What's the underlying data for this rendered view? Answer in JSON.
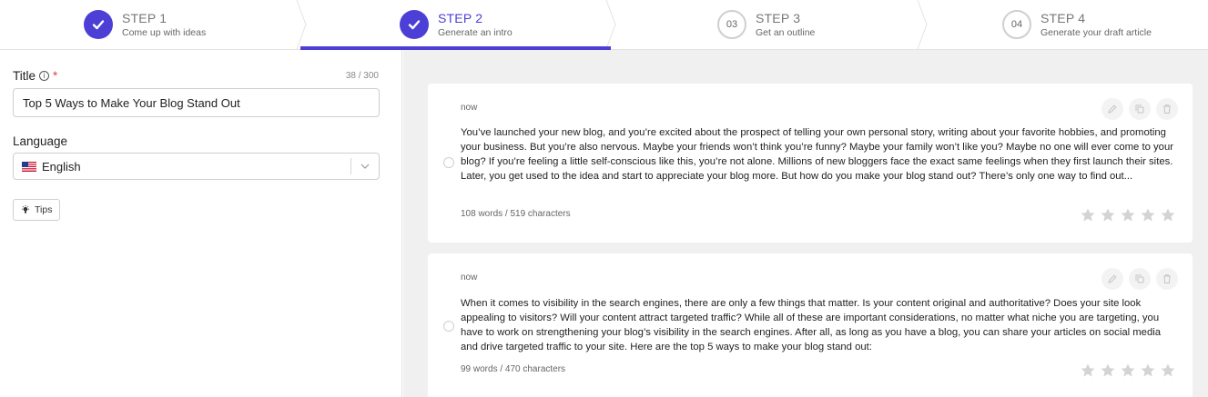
{
  "steps": [
    {
      "title": "STEP 1",
      "subtitle": "Come up with ideas",
      "state": "done"
    },
    {
      "title": "STEP 2",
      "subtitle": "Generate an intro",
      "state": "active"
    },
    {
      "title": "STEP 3",
      "subtitle": "Get an outline",
      "number": "03",
      "state": "todo"
    },
    {
      "title": "STEP 4",
      "subtitle": "Generate your draft article",
      "number": "04",
      "state": "todo"
    }
  ],
  "form": {
    "title_label": "Title",
    "required_mark": "*",
    "title_counter": "38 / 300",
    "title_value": "Top 5 Ways to Make Your Blog Stand Out",
    "language_label": "Language",
    "language_value": "English",
    "tips_label": "Tips"
  },
  "results": [
    {
      "time": "now",
      "text": "You’ve launched your new blog, and you’re excited about the prospect of telling your own personal story, writing about your favorite hobbies, and promoting your business. But you’re also nervous. Maybe your friends won’t think you’re funny? Maybe your family won’t like you? Maybe no one will ever come to your blog? If you’re feeling a little self-conscious like this, you’re not alone. Millions of new bloggers face the exact same feelings when they first launch their sites. Later, you get used to the idea and start to appreciate your blog more. But how do you make your blog stand out? There’s only one way to find out...",
      "meta": "108 words / 519 characters",
      "rating": 0
    },
    {
      "time": "now",
      "text": "When it comes to visibility in the search engines, there are only a few things that matter. Is your content original and authoritative? Does your site look appealing to visitors? Will your content attract targeted traffic? While all of these are important considerations, no matter what niche you are targeting, you have to work on strengthening your blog’s visibility in the search engines. After all, as long as you have a blog, you can share your articles on social media and drive targeted traffic to your site. Here are the top 5 ways to make your blog stand out:",
      "meta": "99 words / 470 characters",
      "rating": 0
    }
  ],
  "colors": {
    "accent": "#4b3fd6",
    "panel_bg": "#f0f0f0",
    "required": "#e0483c"
  },
  "icons": [
    "check-icon",
    "chevron-right-icon",
    "info-icon",
    "us-flag-icon",
    "chevron-down-icon",
    "lightbulb-icon",
    "edit-icon",
    "copy-icon",
    "trash-icon",
    "star-icon"
  ]
}
